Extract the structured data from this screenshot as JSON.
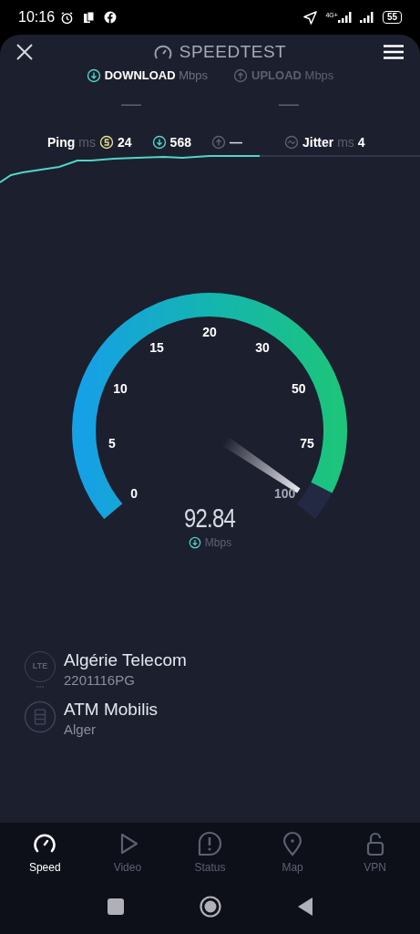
{
  "status_bar": {
    "time": "10:16",
    "network": "4G+",
    "battery": "55"
  },
  "header": {
    "title": "SPEEDTEST"
  },
  "tabs": [
    {
      "label": "DOWNLOAD",
      "unit": "Mbps",
      "value": "—",
      "kind": "download",
      "selected": true
    },
    {
      "label": "UPLOAD",
      "unit": "Mbps",
      "value": "—",
      "kind": "upload",
      "selected": false
    }
  ],
  "metrics": {
    "ping_label": "Ping",
    "ping_unit": "ms",
    "ping": "24",
    "download": "568",
    "upload": "—",
    "jitter_label": "Jitter",
    "jitter_unit": "ms",
    "jitter": "4"
  },
  "gauge": {
    "scale": [
      "0",
      "5",
      "10",
      "15",
      "20",
      "30",
      "50",
      "75",
      "100"
    ],
    "value": "92.84",
    "unit": "Mbps"
  },
  "providers": [
    {
      "kind": "isp",
      "icon_text": "LTE",
      "name": "Algérie Telecom",
      "detail": "2201116PG"
    },
    {
      "kind": "server",
      "name": "ATM Mobilis",
      "detail": "Alger"
    }
  ],
  "nav": [
    {
      "label": "Speed",
      "kind": "speed",
      "selected": true
    },
    {
      "label": "Video",
      "kind": "video",
      "selected": false
    },
    {
      "label": "Status",
      "kind": "status",
      "selected": false
    },
    {
      "label": "Map",
      "kind": "map",
      "selected": false
    },
    {
      "label": "VPN",
      "kind": "vpn",
      "selected": false
    }
  ]
}
